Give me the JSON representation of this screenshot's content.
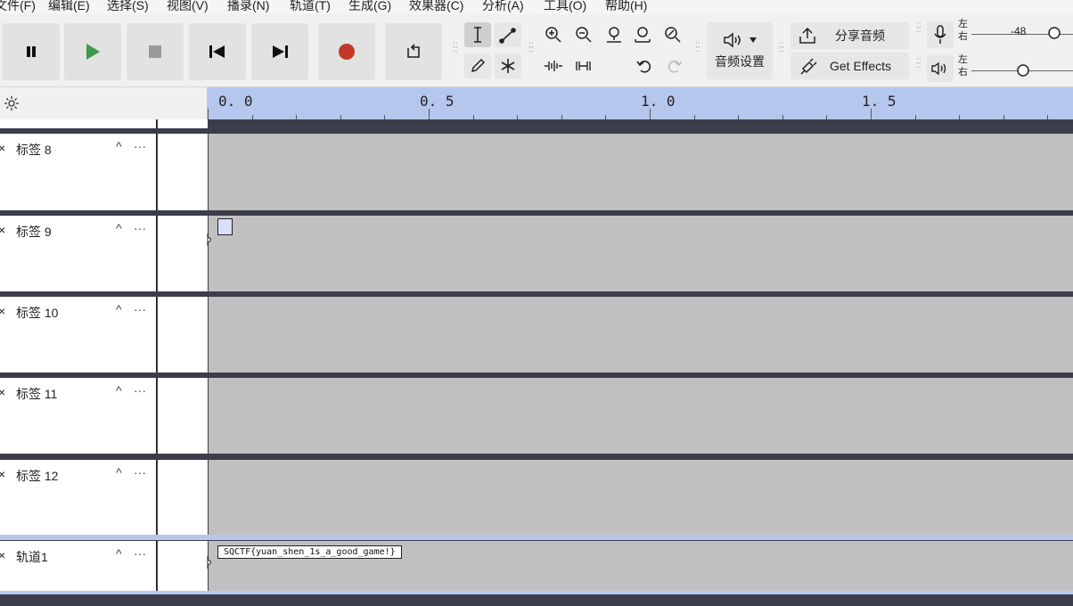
{
  "menu": [
    "文件(F)",
    "编辑(E)",
    "选择(S)",
    "视图(V)",
    "播录(N)",
    "轨道(T)",
    "生成(G)",
    "效果器(C)",
    "分析(A)",
    "工具(O)",
    "帮助(H)"
  ],
  "toolbar": {
    "audio_setup_label": "音频设置",
    "share_audio_label": "分享音频",
    "get_effects_label": "Get Effects",
    "meter_left": "左",
    "meter_right": "右",
    "meter_value": "-48"
  },
  "ruler": {
    "labels": [
      "0. 0",
      "0. 5",
      "1. 0",
      "1. 5"
    ]
  },
  "tracks": [
    {
      "name": "标签 8"
    },
    {
      "name": "标签 9"
    },
    {
      "name": "标签 10"
    },
    {
      "name": "标签 11"
    },
    {
      "name": "标签 12"
    },
    {
      "name": "轨道1",
      "label_text": "SQCTF{yuan_shen_1s_a_good_game!}"
    }
  ],
  "track_controls": {
    "close": "×",
    "collapse": "^",
    "menu": "···"
  },
  "colors": {
    "ruler": "#b6c7ee",
    "track_bg": "#c0c0c0",
    "record": "#c0392b",
    "play": "#3c9a4c"
  }
}
